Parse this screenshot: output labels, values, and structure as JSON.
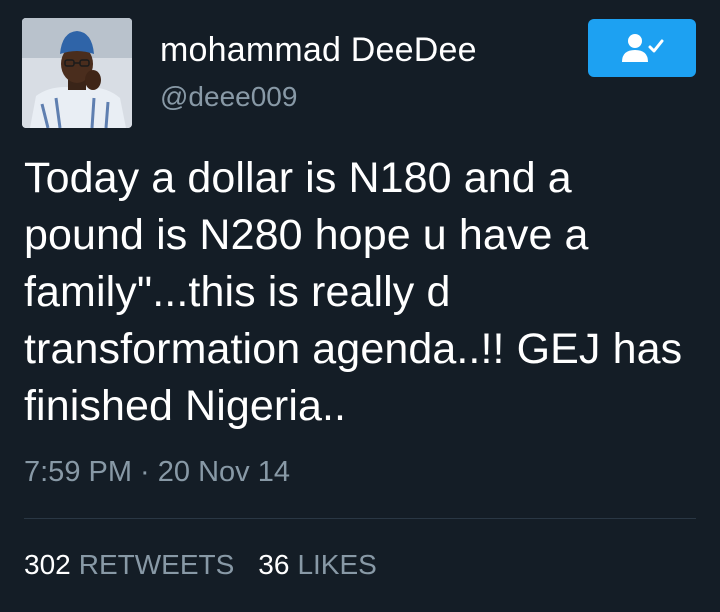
{
  "user": {
    "display_name": "mohammad  DeeDee",
    "handle": "@deee009"
  },
  "follow_button": {
    "icon": "follow-user-icon",
    "color": "#1da1f2"
  },
  "tweet": {
    "lines": [
      "Today a dollar is N180 and a",
      "pound is N280 hope u have a",
      "family\"...this is really d",
      "transformation agenda..!! GEJ has",
      "finished Nigeria.."
    ],
    "timestamp": "7:59 PM · 20 Nov 14"
  },
  "stats": {
    "retweets_count": "302",
    "retweets_label": "RETWEETS",
    "likes_count": "36",
    "likes_label": "LIKES"
  },
  "colors": {
    "background": "#141d26",
    "secondary_text": "#8899a6",
    "accent": "#1da1f2"
  }
}
